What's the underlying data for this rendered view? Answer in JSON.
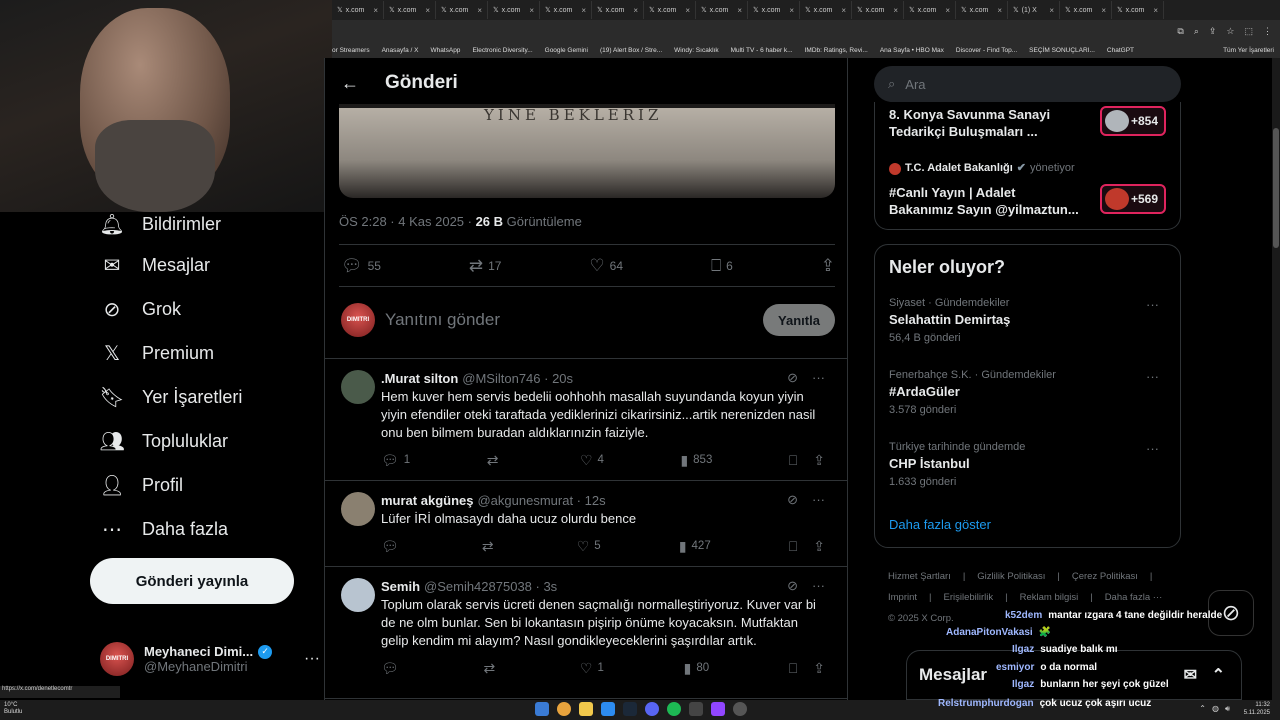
{
  "browser": {
    "tabs": [
      "x.com",
      "x.com",
      "x.com",
      "x.com",
      "x.com",
      "x.com",
      "x.com",
      "x.com",
      "x.com",
      "x.com",
      "x.com",
      "x.com",
      "x.com",
      "(1) X",
      "x.com",
      "x.com"
    ],
    "bookmarks": [
      "or Streamers",
      "Anasayfa / X",
      "WhatsApp",
      "Electronic Diversity...",
      "Google Gemini",
      "(19) Alert Box / Stre...",
      "Windy: Sıcaklık",
      "Multi TV - 6 haber k...",
      "IMDb: Ratings, Revi...",
      "Ana Sayfa • HBO Max",
      "Discover - Find Top...",
      "SEÇİM SONUÇLARI...",
      "ChatGPT",
      "Tüm Yer İşaretleri"
    ],
    "status_url": "https://x.com/denetlecomtr"
  },
  "sidebar": {
    "items": [
      {
        "label": "Bildirimler",
        "icon": "bell-icon"
      },
      {
        "label": "Mesajlar",
        "icon": "mail-icon"
      },
      {
        "label": "Grok",
        "icon": "grok-icon"
      },
      {
        "label": "Premium",
        "icon": "x-logo-icon"
      },
      {
        "label": "Yer İşaretleri",
        "icon": "bookmark-icon"
      },
      {
        "label": "Topluluklar",
        "icon": "communities-icon"
      },
      {
        "label": "Profil",
        "icon": "person-icon"
      },
      {
        "label": "Daha fazla",
        "icon": "more-circle-icon"
      }
    ],
    "post_button": "Gönderi yayınla",
    "profile": {
      "name": "Meyhaneci Dimi...",
      "handle": "@MeyhaneDimitri",
      "avatar_text": "DIMITRI"
    }
  },
  "main": {
    "header_title": "Gönderi",
    "media_text": "YINE BEKLERIZ",
    "meta": {
      "time": "ÖS 2:28 · 4 Kas 2025 · ",
      "views": "26 B",
      "views_label": " Görüntüleme"
    },
    "stats": {
      "replies": "55",
      "reposts": "17",
      "likes": "64",
      "bookmarks": "6"
    },
    "reply_placeholder": "Yanıtını gönder",
    "reply_button": "Yanıtla",
    "replies": [
      {
        "name": ".Murat silton",
        "handle": "@MSilton746 · 20s",
        "text": "Hem kuver hem servis bedelii oohhohh masallah suyundanda koyun yiyin yiyin efendiler oteki taraftada yediklerinizi cikarirsiniz...artik nerenizden nasil onu ben bilmem buradan aldıklarınızin faiziyle.",
        "replies": "1",
        "reposts": "",
        "likes": "4",
        "views": "853",
        "avatar_color": "#4a5a4a"
      },
      {
        "name": "murat akgüneş",
        "handle": "@akgunesmurat · 12s",
        "text": "Lüfer İRİ olmasaydı daha ucuz olurdu bence",
        "replies": "",
        "reposts": "",
        "likes": "5",
        "views": "427",
        "avatar_color": "#8a8070"
      },
      {
        "name": "Semih",
        "handle": "@Semih42875038 · 3s",
        "text": "Toplum olarak servis ücreti denen saçmalığı normalleştiriyoruz. Kuver var bi de ne olm bunlar. Sen bi lokantasın pişirip önüme koyacaksın. Mutfaktan gelip kendim mi alayım? Nasıl gondikleyeceklerini şaşırdılar artık.",
        "replies": "",
        "reposts": "",
        "likes": "1",
        "views": "80",
        "avatar_color": "#b8c4d0"
      }
    ]
  },
  "right": {
    "search_placeholder": "Ara",
    "promoted": [
      {
        "title_line1": "8. Konya Savunma Sanayi",
        "title_line2": "Tedarikçi Buluşmaları ...",
        "badge": "+854"
      },
      {
        "account": "T.C. Adalet Bakanlığı",
        "account_suffix": "yönetiyor",
        "title_line1": "#Canlı Yayın | Adalet",
        "title_line2": "Bakanımız Sayın @yilmaztun...",
        "badge": "+569"
      }
    ],
    "happening_title": "Neler oluyor?",
    "trends": [
      {
        "context": "Siyaset · Gündemdekiler",
        "title": "Selahattin Demirtaş",
        "count": "56,4 B gönderi"
      },
      {
        "context": "Fenerbahçe S.K. · Gündemdekiler",
        "title": "#ArdaGüler",
        "count": "3.578 gönderi"
      },
      {
        "context": "Türkiye tarihinde gündemde",
        "title": "CHP İstanbul",
        "count": "1.633 gönderi"
      }
    ],
    "show_more": "Daha fazla göster",
    "footer_line1": [
      "Hizmet Şartları",
      "|",
      "Gizlilik Politikası",
      "|",
      "Çerez Politikası",
      "|"
    ],
    "footer_line2": [
      "Imprint",
      "|",
      "Erişilebilirlik",
      "|",
      "Reklam bilgisi",
      "|",
      "Daha fazla ···"
    ],
    "footer_line3": "© 2025 X Corp."
  },
  "messages_drawer": "Mesajlar",
  "chat": [
    {
      "user": "k52dem",
      "msg": "mantar ızgara 4 tane değildir heralde"
    },
    {
      "user": "AdanaPitonVakasi",
      "msg": "🧩"
    },
    {
      "user": "Ilgaz",
      "msg": "suadiye balık mı"
    },
    {
      "user": "esmiyor",
      "msg": "o da normal"
    },
    {
      "user": "Ilgaz",
      "msg": "bunların her şeyi çok güzel"
    },
    {
      "user": "Relstrumphurdogan",
      "msg": "çok ucuz çok aşırı ucuz"
    }
  ],
  "taskbar": {
    "temp": "10°C",
    "weather": "Bulutlu",
    "time": "11:32",
    "date": "5.11.2025"
  },
  "colors": {
    "accent": "#1d9bf0",
    "badge_border": "#e0245e",
    "chat_user": "#9fb8ff"
  }
}
